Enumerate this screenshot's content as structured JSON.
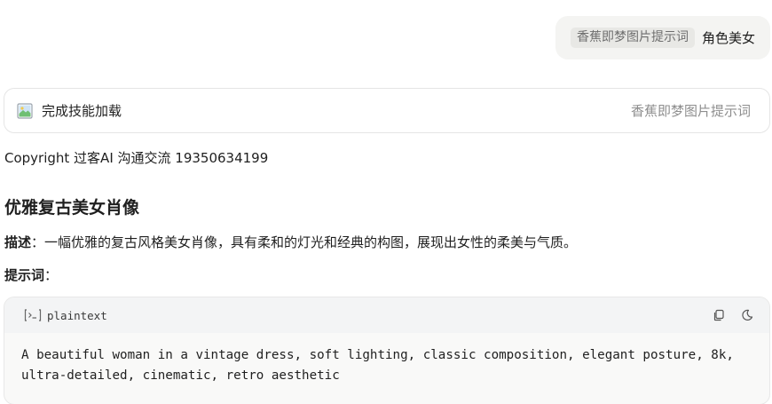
{
  "user_message": {
    "skill_tag": "香蕉即梦图片提示词",
    "text": "角色美女"
  },
  "skill_card": {
    "status": "完成技能加载",
    "skill_name": "香蕉即梦图片提示词",
    "icon": "image-icon"
  },
  "copyright": "Copyright 过客AI 沟通交流 19350634199",
  "content": {
    "heading": "优雅复古美女肖像",
    "desc_label": "描述",
    "desc_text": "：一幅优雅的复古风格美女肖像，具有柔和的灯光和经典的构图，展现出女性的柔美与气质。",
    "prompt_label": "提示词",
    "prompt_colon": "："
  },
  "code_block": {
    "language": "plaintext",
    "language_icon": "terminal-icon",
    "copy_icon": "copy-icon",
    "theme_icon": "moon-icon",
    "code": "A beautiful woman in a vintage dress, soft lighting, classic composition, elegant posture, 8k,\nultra-detailed, cinematic, retro aesthetic"
  }
}
